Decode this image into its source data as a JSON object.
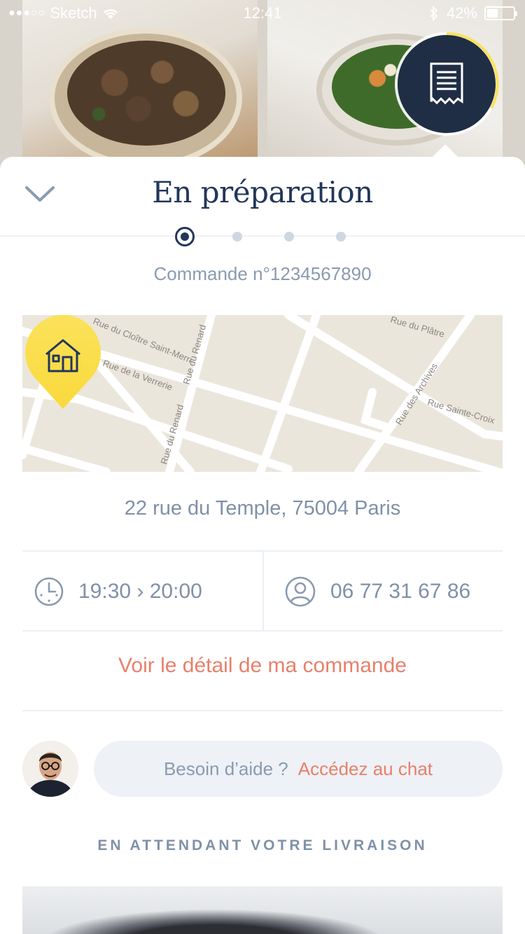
{
  "status_bar": {
    "signal": "●●●○○",
    "carrier": "Sketch",
    "time": "12:41",
    "battery_percent": "42%",
    "battery_level": 0.42
  },
  "header": {
    "title": "En préparation",
    "collapse_icon": "chevron-down-icon",
    "receipt_icon": "receipt-icon"
  },
  "progress": {
    "steps_total": 4,
    "current_step": 1
  },
  "order": {
    "number_label": "Commande n°1234567890"
  },
  "map": {
    "streets": [
      "Rue du Cloître Saint-Merri",
      "Rue du Renard",
      "Rue du Renard",
      "Rue de la Verrerie",
      "Rue du Plâtre",
      "Rue des Archives",
      "Rue Sainte-Croix"
    ],
    "pin_icon": "home-icon"
  },
  "delivery": {
    "address": "22 rue du Temple, 75004 Paris",
    "time_slot": "19:30 › 20:00",
    "phone": "06 77 31 67 86"
  },
  "links": {
    "order_detail": "Voir le détail de ma commande"
  },
  "chat": {
    "question": "Besoin d’aide ?",
    "link": "Accédez au chat"
  },
  "section": {
    "waiting_title": "EN ATTENDANT VOTRE LIVRAISON"
  },
  "colors": {
    "navy": "#22375a",
    "accent_coral": "#e8806b",
    "pin_yellow": "#fbe25a",
    "text_muted": "#7f91a8"
  }
}
